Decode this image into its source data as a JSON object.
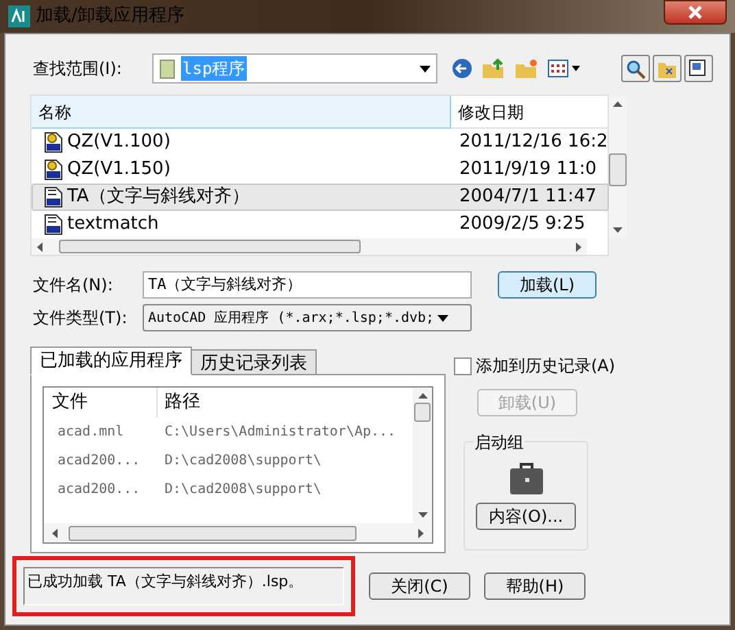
{
  "window": {
    "title": "加载/卸载应用程序"
  },
  "look_in": {
    "label": "查找范围(I):",
    "value": "lsp程序"
  },
  "file_list": {
    "columns": [
      "名称",
      "修改日期"
    ],
    "rows": [
      {
        "name": "QZ(V1.100)",
        "date": "2011/12/16 16:2",
        "kind": "dvb",
        "selected": false
      },
      {
        "name": "QZ(V1.150)",
        "date": "2011/9/19 11:0",
        "kind": "dvb",
        "selected": false
      },
      {
        "name": "TA（文字与斜线对齐）",
        "date": "2004/7/1 11:47",
        "kind": "lsp",
        "selected": true
      },
      {
        "name": "textmatch",
        "date": "2009/2/5 9:25",
        "kind": "lsp",
        "selected": false
      }
    ]
  },
  "file_name": {
    "label": "文件名(N):",
    "value": "TA（文字与斜线对齐）"
  },
  "load_button": "加载(L)",
  "file_type": {
    "label": "文件类型(T):",
    "value": "AutoCAD 应用程序 (*.arx;*.lsp;*.dvb;"
  },
  "tabs": [
    {
      "label": "已加载的应用程序",
      "selected": true
    },
    {
      "label": "历史记录列表",
      "selected": false
    }
  ],
  "loaded_apps": {
    "columns": [
      "文件",
      "路径"
    ],
    "rows": [
      {
        "file": "acad.mnl",
        "path": "C:\\Users\\Administrator\\Ap..."
      },
      {
        "file": "acad200...",
        "path": "D:\\cad2008\\support\\"
      },
      {
        "file": "acad200...",
        "path": "D:\\cad2008\\support\\"
      }
    ]
  },
  "add_to_history": {
    "label": "添加到历史记录(A)",
    "checked": false
  },
  "unload_button": {
    "label": "卸载(U)",
    "disabled": true
  },
  "startup_group": {
    "title": "启动组",
    "button": "内容(O)..."
  },
  "status": {
    "text": "已成功加载 TA（文字与斜线对齐）.lsp。",
    "highlighted": true
  },
  "buttons": [
    "关闭(C)",
    "帮助(H)"
  ]
}
